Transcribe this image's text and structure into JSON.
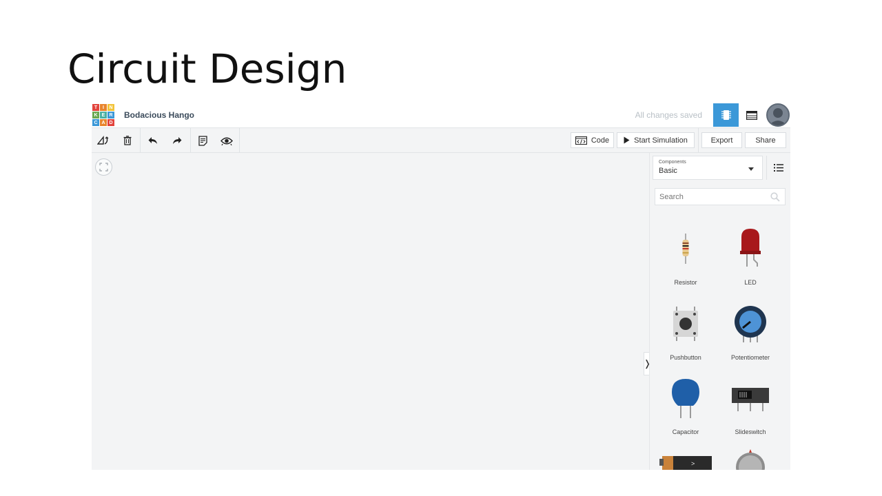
{
  "slide": {
    "title": "Circuit Design"
  },
  "app": {
    "logo_letters": [
      "T",
      "I",
      "N",
      "K",
      "E",
      "R",
      "C",
      "A",
      "D"
    ],
    "logo_colors": [
      "#e2433c",
      "#e8842d",
      "#f2c43a",
      "#6aa84f",
      "#4ab1a3",
      "#3b98d8",
      "#3b98d8",
      "#e8842d",
      "#e2433c"
    ],
    "project_name": "Bodacious Hango",
    "save_status": "All changes saved",
    "header_icons": [
      "circuit-view-icon",
      "components-list-icon",
      "user-avatar"
    ],
    "accent_color": "#3b98d8"
  },
  "toolbar": {
    "tools": [
      "rotate-icon",
      "delete-icon",
      "undo-icon",
      "redo-icon",
      "notes-icon",
      "view-icon"
    ],
    "code_label": "Code",
    "start_sim_label": "Start Simulation",
    "export_label": "Export",
    "share_label": "Share"
  },
  "panel": {
    "components_caption": "Components",
    "components_value": "Basic",
    "search_placeholder": "Search",
    "items": [
      {
        "label": "Resistor"
      },
      {
        "label": "LED"
      },
      {
        "label": "Pushbutton"
      },
      {
        "label": "Potentiometer"
      },
      {
        "label": "Capacitor"
      },
      {
        "label": "Slideswitch"
      }
    ]
  }
}
